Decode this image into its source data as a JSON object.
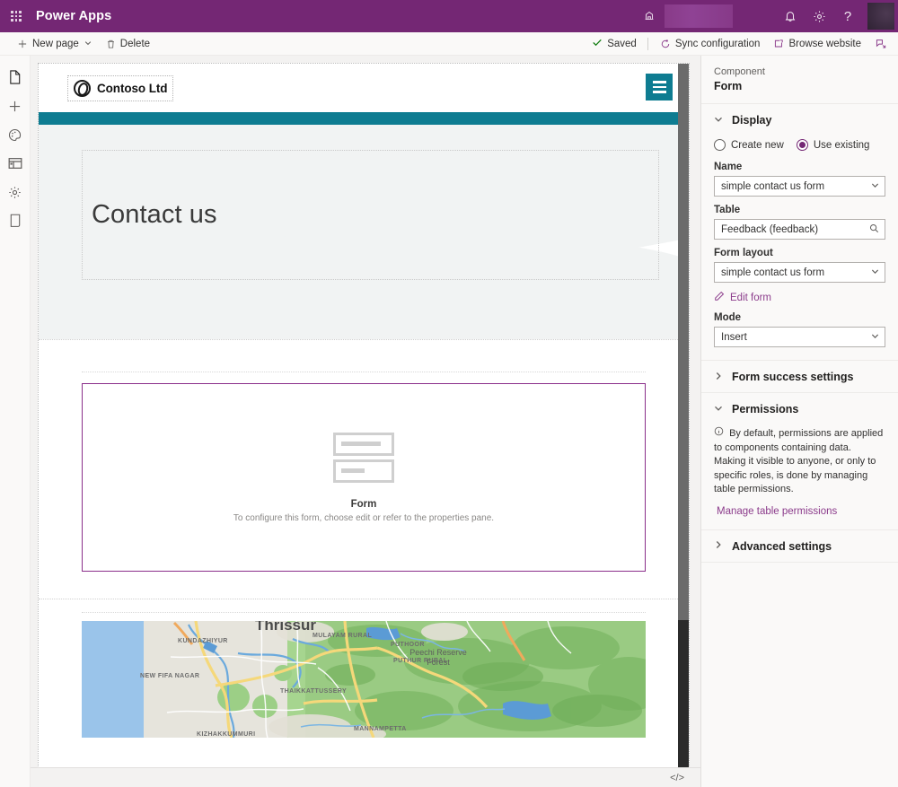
{
  "suitebar": {
    "brand": "Power Apps",
    "waffle_icon": "app-launcher-icon",
    "env_icon": "environment-icon",
    "icons": [
      {
        "name": "notifications-icon",
        "glyph": "🔔"
      },
      {
        "name": "settings-gear-icon",
        "glyph": "⚙"
      },
      {
        "name": "help-icon",
        "glyph": "?"
      }
    ],
    "avatar": "user-avatar",
    "bg_color": "#742774"
  },
  "commandbar": {
    "new_page_label": "New page",
    "new_page_icon": "plus-icon",
    "new_page_chevron": "chevron-down-icon",
    "delete_label": "Delete",
    "delete_icon": "trash-icon",
    "saved_label": "Saved",
    "saved_icon": "checkmark-icon",
    "sync_label": "Sync configuration",
    "sync_icon": "sync-circle-icon",
    "browse_label": "Browse website",
    "browse_icon": "open-window-icon",
    "pin_icon": "pin-pane-icon"
  },
  "rail": {
    "items": [
      {
        "name": "sidebar-item-pages",
        "icon": "page-icon",
        "glyph": "⬜",
        "active": true
      },
      {
        "name": "sidebar-item-add",
        "icon": "plus-icon",
        "glyph": "＋",
        "active": false
      },
      {
        "name": "sidebar-item-theme",
        "icon": "palette-icon",
        "glyph": "◔",
        "active": false
      },
      {
        "name": "sidebar-item-data",
        "icon": "data-table-icon",
        "glyph": "▤",
        "active": false
      },
      {
        "name": "sidebar-item-settings",
        "icon": "gear-icon",
        "glyph": "⚙",
        "active": false
      },
      {
        "name": "sidebar-item-device",
        "icon": "mobile-device-icon",
        "glyph": "▯",
        "active": false
      }
    ]
  },
  "canvas": {
    "site": {
      "logo_text": "Contoso Ltd",
      "logo_icon": "contoso-logo-icon",
      "menu_icon": "hamburger-menu-icon",
      "nav_color": "#0e7c91"
    },
    "hero": {
      "title": "Contact us"
    },
    "form_placeholder": {
      "icon": "form-fields-icon",
      "title": "Form",
      "subtitle": "To configure this form, choose edit or refer to the properties pane."
    },
    "map": {
      "icon": "map-embed",
      "city_label": "Thrissur",
      "labels": [
        "KUNDAZHIYUR",
        "NEW FIFA NAGAR",
        "THAIKKATTUSSERY",
        "MULAYAM RURAL",
        "PUTHOOR",
        "PUTHUR RURAL",
        "MANNAMPETTA",
        "Peechi Reserve Forest"
      ]
    },
    "code_icon": "code-view-icon"
  },
  "pane": {
    "kicker": "Component",
    "title": "Form",
    "display": {
      "label": "Display",
      "chevron": "chevron-down-icon",
      "radios": [
        {
          "label": "Create new",
          "selected": false
        },
        {
          "label": "Use existing",
          "selected": true
        }
      ],
      "name_label": "Name",
      "name_value": "simple contact us form",
      "name_icon": "chevron-down-icon",
      "table_label": "Table",
      "table_value": "Feedback (feedback)",
      "table_icon": "search-icon",
      "form_layout_label": "Form layout",
      "form_layout_value": "simple contact us form",
      "form_layout_icon": "chevron-down-icon",
      "edit_form_label": "Edit form",
      "edit_form_icon": "pencil-icon",
      "mode_label": "Mode",
      "mode_value": "Insert",
      "mode_icon": "chevron-down-icon"
    },
    "form_success": {
      "label": "Form success settings",
      "chevron": "chevron-right-icon"
    },
    "permissions": {
      "label": "Permissions",
      "chevron": "chevron-down-icon",
      "info_icon": "info-icon",
      "note": "By default, permissions are applied to components containing data. Making it visible to anyone, or only to specific roles, is done by managing table permissions.",
      "link_label": "Manage table permissions"
    },
    "advanced": {
      "label": "Advanced settings",
      "chevron": "chevron-right-icon"
    },
    "accent_color": "#742774"
  }
}
